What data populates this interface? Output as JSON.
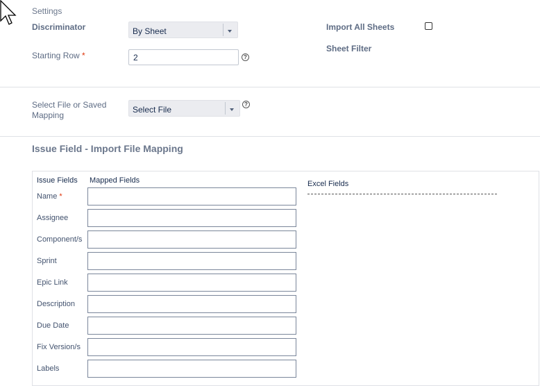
{
  "settings": {
    "heading": "Settings",
    "discriminator_label": "Discriminator",
    "discriminator_value": "By Sheet",
    "starting_row_label": "Starting Row",
    "starting_row_value": "2",
    "import_all_sheets_label": "Import All Sheets",
    "sheet_filter_label": "Sheet Filter",
    "required_mark": "*",
    "help_glyph": "?"
  },
  "file": {
    "label_line1": "Select File or Saved",
    "label_line2": "Mapping",
    "select_value": "Select File"
  },
  "mapping": {
    "title": "Issue Field - Import File Mapping",
    "col_issue_fields": "Issue Fields",
    "col_mapped_fields": "Mapped Fields",
    "excel_fields_label": "Excel Fields",
    "rows": [
      {
        "label": "Name",
        "required": "*"
      },
      {
        "label": "Assignee",
        "required": ""
      },
      {
        "label": "Component/s",
        "required": ""
      },
      {
        "label": "Sprint",
        "required": ""
      },
      {
        "label": "Epic Link",
        "required": ""
      },
      {
        "label": "Description",
        "required": ""
      },
      {
        "label": "Due Date",
        "required": ""
      },
      {
        "label": "Fix Version/s",
        "required": ""
      },
      {
        "label": "Labels",
        "required": ""
      }
    ]
  }
}
